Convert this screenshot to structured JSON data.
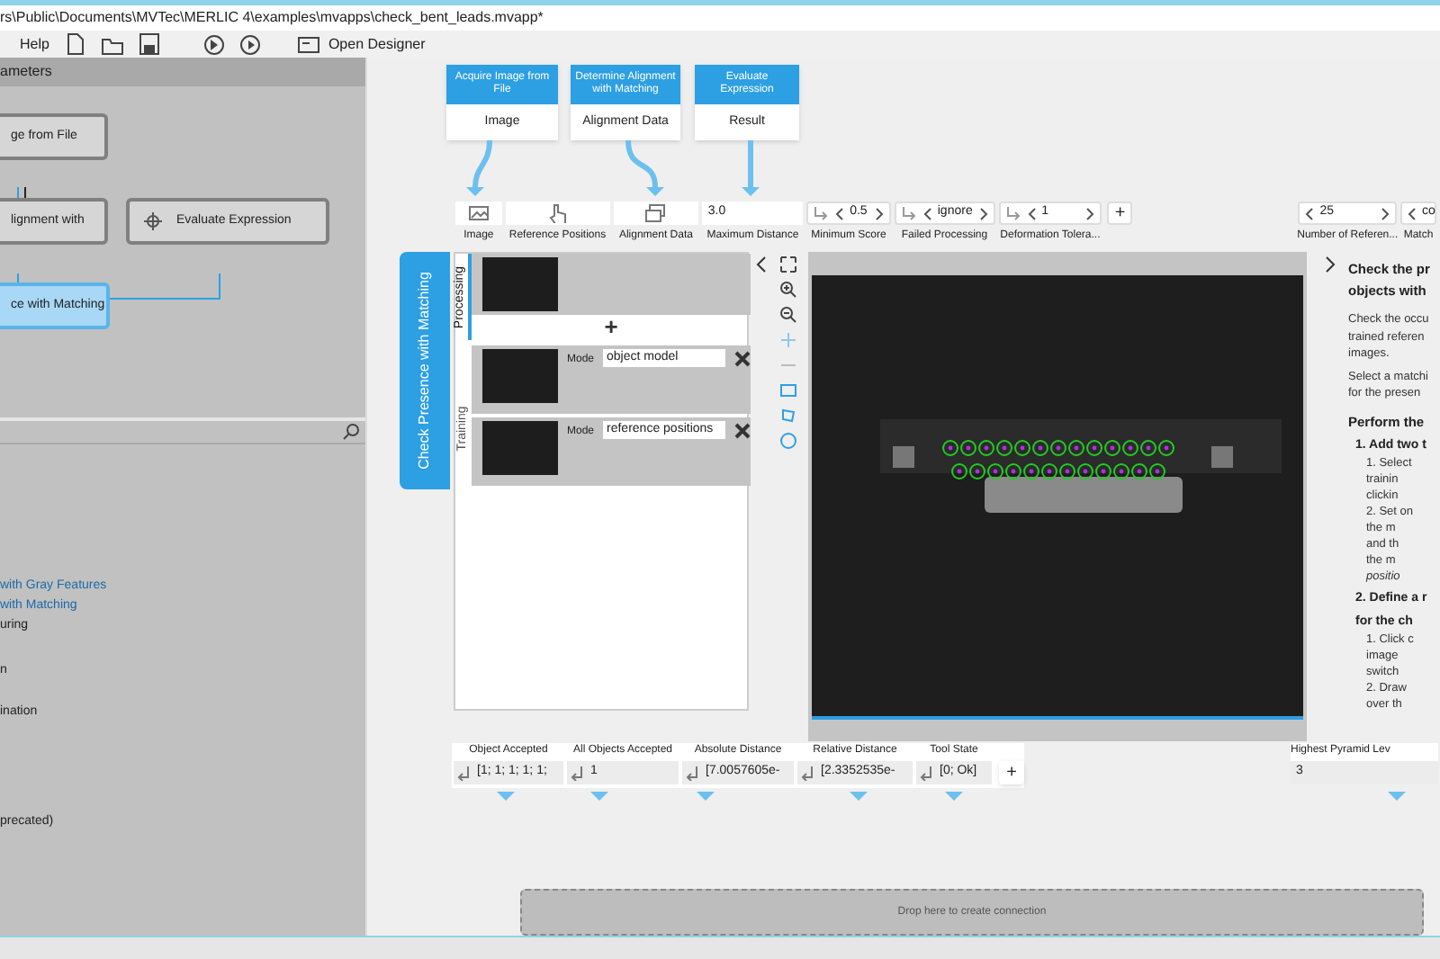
{
  "title_bar": {
    "path": "rs\\Public\\Documents\\MVTec\\MERLIC 4\\examples\\mvapps\\check_bent_leads.mvapp*"
  },
  "menu": [
    "Help"
  ],
  "toolbar": {
    "designer_button": "Open Designer"
  },
  "flow_panel": {
    "header": "ameters",
    "nodes": [
      {
        "label": "ge from File",
        "selected": false
      },
      {
        "label": "lignment with",
        "selected": false
      },
      {
        "label": "Evaluate Expression",
        "selected": false
      },
      {
        "label": "ce with Matching",
        "selected": true
      }
    ]
  },
  "tool_list": [
    {
      "label": "with Gray Features",
      "kind": "link"
    },
    {
      "label": "with Matching",
      "kind": "link"
    },
    {
      "label": "uring",
      "kind": "plain"
    },
    {
      "label": "n",
      "kind": "plain"
    },
    {
      "label": "ination",
      "kind": "plain"
    },
    {
      "label": "precated)",
      "kind": "plain"
    }
  ],
  "source_tools": [
    {
      "title": "Acquire Image from File",
      "output": "Image"
    },
    {
      "title": "Determine Alignment with Matching",
      "output": "Alignment Data"
    },
    {
      "title": "Evaluate Expression",
      "output": "Result"
    }
  ],
  "tool_tab": "Check Presence with Matching",
  "inputs": [
    {
      "kind": "icon",
      "label": "Image"
    },
    {
      "kind": "icon",
      "label": "Reference Positions"
    },
    {
      "kind": "icon",
      "label": "Alignment Data"
    },
    {
      "kind": "value",
      "value": "3.0",
      "label": "Maximum Distance"
    },
    {
      "kind": "spin",
      "value": "0.5",
      "label": "Minimum Score"
    },
    {
      "kind": "spin",
      "value": "ignore",
      "label": "Failed Processing"
    },
    {
      "kind": "spin",
      "value": "1",
      "label": "Deformation Tolera..."
    },
    {
      "kind": "add",
      "value": "+"
    },
    {
      "kind": "spin_plain",
      "value": "25",
      "label": "Number of Referen..."
    },
    {
      "kind": "spin_plain",
      "value": "co",
      "label": "Match"
    }
  ],
  "side_tabs": [
    {
      "label": "Processing",
      "selected": true
    },
    {
      "label": "Training",
      "selected": false
    }
  ],
  "processing": {
    "add": "+"
  },
  "training": [
    {
      "mode_label": "Mode",
      "mode": "object model"
    },
    {
      "mode_label": "Mode",
      "mode": "reference positions"
    }
  ],
  "help": [
    {
      "kind": "title",
      "text": "Check the pr"
    },
    {
      "kind": "title",
      "text": "objects with"
    },
    {
      "kind": "para",
      "text": "Check the occu"
    },
    {
      "kind": "para",
      "text": "trained referen"
    },
    {
      "kind": "para",
      "text": "images."
    },
    {
      "kind": "para",
      "text": "Select a matchi"
    },
    {
      "kind": "para",
      "text": "for the presen"
    },
    {
      "kind": "heading",
      "text": "Perform the"
    },
    {
      "kind": "step",
      "text": "1. Add two t"
    },
    {
      "kind": "sub",
      "text": "1. Select"
    },
    {
      "kind": "sub",
      "text": "trainin"
    },
    {
      "kind": "sub",
      "text": "clickin"
    },
    {
      "kind": "sub",
      "text": "2. Set on"
    },
    {
      "kind": "sub",
      "text": "the m"
    },
    {
      "kind": "sub",
      "text": "and th"
    },
    {
      "kind": "sub",
      "text": "the m"
    },
    {
      "kind": "subitalic",
      "text": "positio"
    },
    {
      "kind": "step",
      "text": "2. Define a r"
    },
    {
      "kind": "step",
      "text": "for the ch"
    },
    {
      "kind": "sub",
      "text": "1. Click c"
    },
    {
      "kind": "sub",
      "text": "image"
    },
    {
      "kind": "sub",
      "text": "switch"
    },
    {
      "kind": "sub",
      "text": "2. Draw"
    },
    {
      "kind": "sub",
      "text": "over th"
    }
  ],
  "outputs": [
    {
      "kind": "value",
      "label": "Object Accepted",
      "value": "[1; 1; 1; 1; 1;"
    },
    {
      "kind": "value",
      "label": "All Objects Accepted",
      "value": "1"
    },
    {
      "kind": "value",
      "label": "Absolute Distance",
      "value": "[7.0057605e-"
    },
    {
      "kind": "value",
      "label": "Relative Distance",
      "value": "[2.3352535e-"
    },
    {
      "kind": "value",
      "label": "Tool State",
      "value": "[0; Ok]"
    },
    {
      "kind": "add",
      "value": "+"
    }
  ],
  "pyramid": {
    "label": "Highest Pyramid Lev",
    "value": "3"
  },
  "drop_zone": "Drop here to create connection"
}
